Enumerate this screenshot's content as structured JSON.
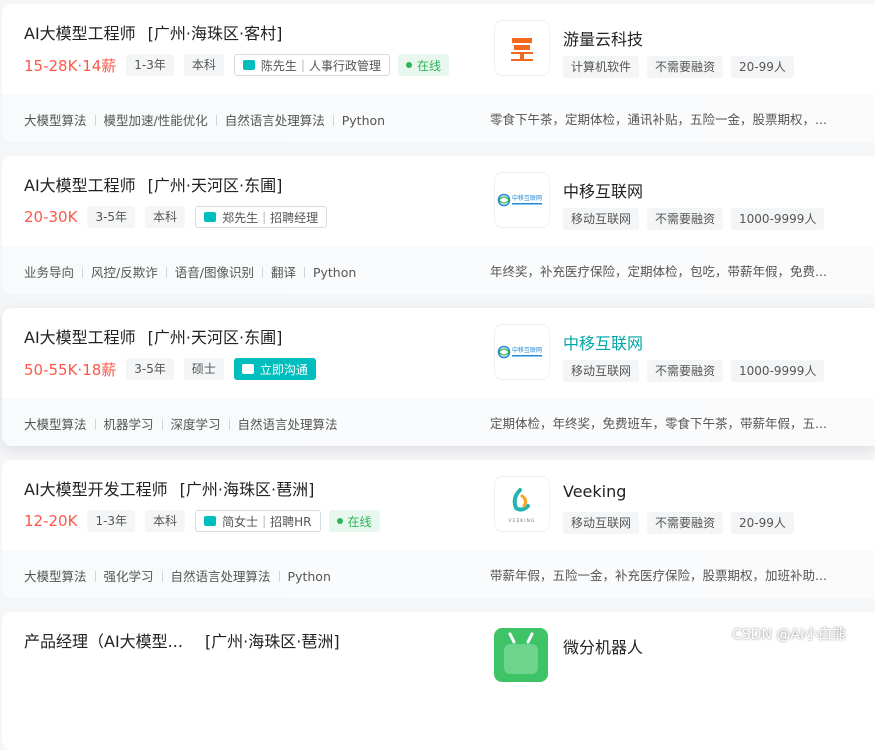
{
  "jobs": [
    {
      "title": "AI大模型工程师",
      "location": "[广州·海珠区·客村]",
      "salary": "15-28K·14薪",
      "experience": "1-3年",
      "degree": "本科",
      "recruiter_name": "陈先生",
      "recruiter_role": "人事行政管理",
      "status": "在线",
      "skills": [
        "大模型算法",
        "模型加速/性能优化",
        "自然语言处理算法",
        "Python"
      ],
      "benefits": "零食下午茶，定期体检，通讯补贴，五险一金，股票期权，...",
      "company": "游量云科技",
      "company_tags": [
        "计算机软件",
        "不需要融资",
        "20-99人"
      ],
      "logo_icon": "youliang-logo-icon"
    },
    {
      "title": "AI大模型工程师",
      "location": "[广州·天河区·东圃]",
      "salary": "20-30K",
      "experience": "3-5年",
      "degree": "本科",
      "recruiter_name": "郑先生",
      "recruiter_role": "招聘经理",
      "status": "",
      "skills": [
        "业务导向",
        "风控/反欺诈",
        "语音/图像识别",
        "翻译",
        "Python"
      ],
      "benefits": "年终奖，补充医疗保险，定期体检，包吃，带薪年假，免费...",
      "company": "中移互联网",
      "company_tags": [
        "移动互联网",
        "不需要融资",
        "1000-9999人"
      ],
      "logo_icon": "china-mobile-logo-icon",
      "logo_text": "中移互联网"
    },
    {
      "title": "AI大模型工程师",
      "location": "[广州·天河区·东圃]",
      "salary": "50-55K·18薪",
      "experience": "3-5年",
      "degree": "硕士",
      "chat_button": "立即沟通",
      "skills": [
        "大模型算法",
        "机器学习",
        "深度学习",
        "自然语言处理算法"
      ],
      "benefits": "定期体检，年终奖，免费班车，零食下午茶，带薪年假，五...",
      "company": "中移互联网",
      "company_tags": [
        "移动互联网",
        "不需要融资",
        "1000-9999人"
      ],
      "logo_icon": "china-mobile-logo-icon",
      "logo_text": "中移互联网"
    },
    {
      "title": "AI大模型开发工程师",
      "location": "[广州·海珠区·琶洲]",
      "salary": "12-20K",
      "experience": "1-3年",
      "degree": "本科",
      "recruiter_name": "简女士",
      "recruiter_role": "招聘HR",
      "status": "在线",
      "skills": [
        "大模型算法",
        "强化学习",
        "自然语言处理算法",
        "Python"
      ],
      "benefits": "带薪年假，五险一金，补充医疗保险，股票期权，加班补助...",
      "company": "Veeking",
      "company_tags": [
        "移动互联网",
        "不需要融资",
        "20-99人"
      ],
      "logo_icon": "veeking-logo-icon",
      "logo_text": "VEEKING"
    },
    {
      "title": "产品经理（AI大模型...",
      "location": "[广州·海珠区·琶洲]",
      "company": "微分机器人",
      "logo_icon": "robot-logo-icon"
    }
  ],
  "watermark": "CSDN @AI小白熊",
  "colors": {
    "salary": "#fe574a",
    "accent": "#00bebd",
    "online": "#2db455"
  }
}
